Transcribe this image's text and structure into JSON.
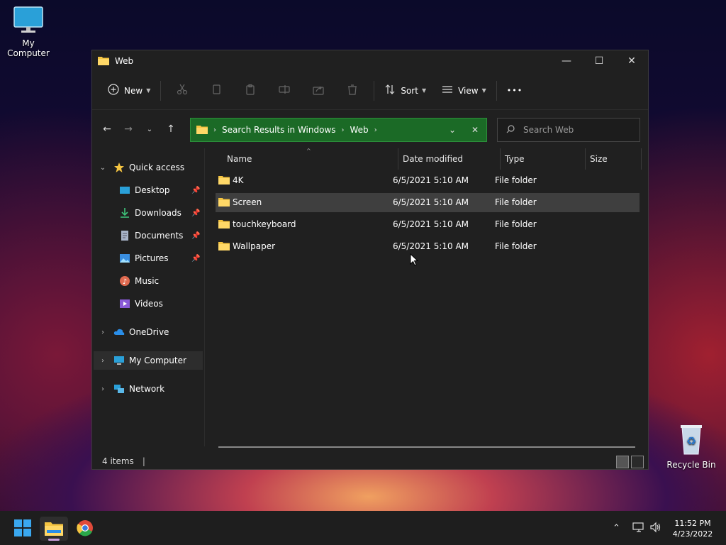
{
  "desktop": {
    "my_computer_label": "My Computer",
    "recycle_bin_label": "Recycle Bin"
  },
  "window": {
    "title": "Web",
    "controls": {
      "minimize": "—",
      "maximize": "☐",
      "close": "✕"
    }
  },
  "commandbar": {
    "new_label": "New",
    "sort_label": "Sort",
    "view_label": "View",
    "more_label": "•••"
  },
  "address": {
    "crumbs": [
      "Search Results in Windows",
      "Web"
    ]
  },
  "search": {
    "placeholder": "Search Web"
  },
  "navpane": {
    "quick_access": "Quick access",
    "desktop": "Desktop",
    "downloads": "Downloads",
    "documents": "Documents",
    "pictures": "Pictures",
    "music": "Music",
    "videos": "Videos",
    "onedrive": "OneDrive",
    "my_computer": "My Computer",
    "network": "Network"
  },
  "columns": {
    "name": "Name",
    "date": "Date modified",
    "type": "Type",
    "size": "Size"
  },
  "files": [
    {
      "name": "4K",
      "date": "6/5/2021 5:10 AM",
      "type": "File folder"
    },
    {
      "name": "Screen",
      "date": "6/5/2021 5:10 AM",
      "type": "File folder"
    },
    {
      "name": "touchkeyboard",
      "date": "6/5/2021 5:10 AM",
      "type": "File folder"
    },
    {
      "name": "Wallpaper",
      "date": "6/5/2021 5:10 AM",
      "type": "File folder"
    }
  ],
  "status": {
    "item_count": "4 items"
  },
  "clock": {
    "time": "11:52 PM",
    "date": "4/23/2022"
  },
  "colors": {
    "address_bg": "#1b6a26",
    "folder": "#f5c542",
    "window_bg": "#202020",
    "taskbar_bg": "#1e1e1e"
  }
}
